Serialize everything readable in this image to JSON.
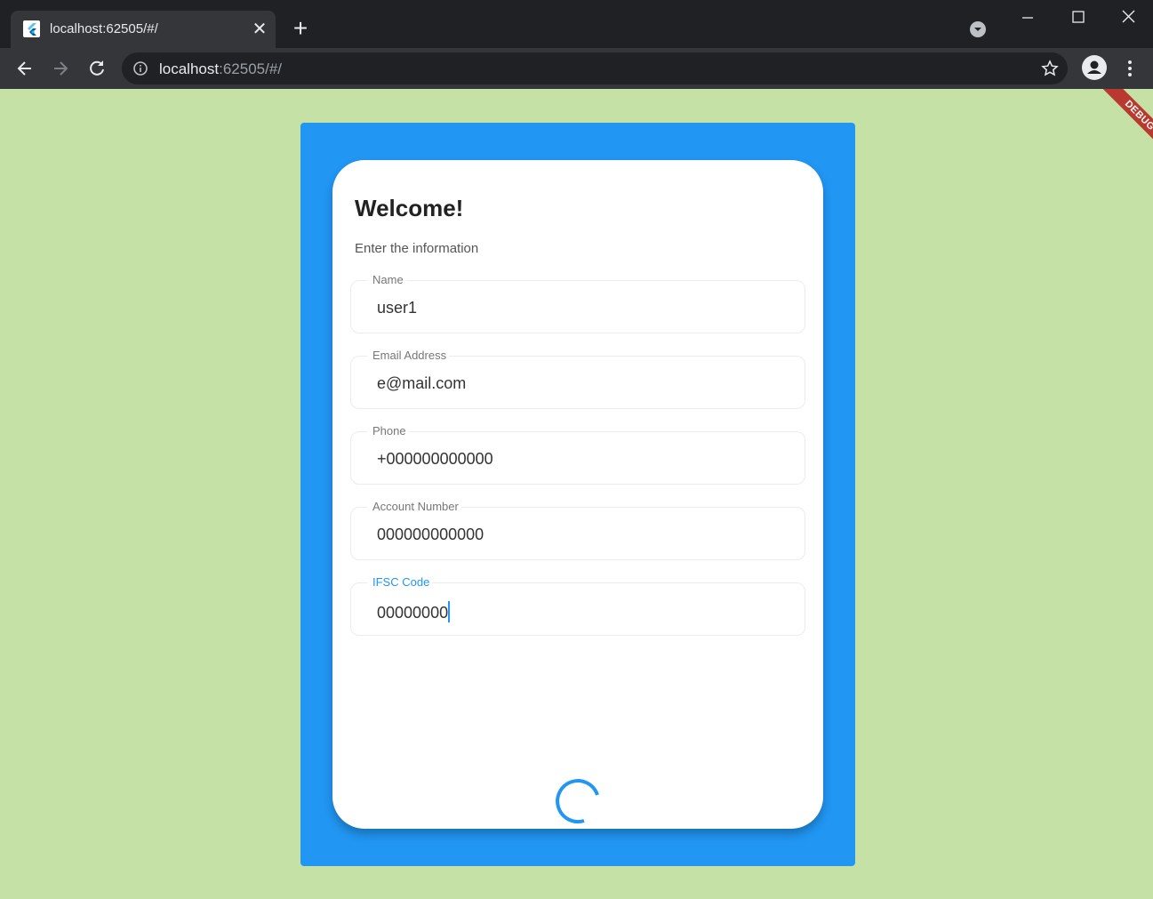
{
  "browser": {
    "tab": {
      "title": "localhost:62505/#/",
      "close": "✕"
    },
    "new_tab": "+",
    "url": {
      "host": "localhost",
      "rest": ":62505/#/"
    }
  },
  "debug_banner": "DEBUG",
  "form": {
    "title": "Welcome!",
    "subtitle": "Enter the information",
    "fields": [
      {
        "label": "Name",
        "value": "user1"
      },
      {
        "label": "Email Address",
        "value": "e@mail.com"
      },
      {
        "label": "Phone",
        "value": "+000000000000"
      },
      {
        "label": "Account Number",
        "value": "000000000000"
      },
      {
        "label": "IFSC Code",
        "value": "00000000",
        "focused": true
      }
    ]
  },
  "colors": {
    "page_background": "#c5e1a5",
    "panel": "#2196f3",
    "accent": "#2196f3",
    "debug": "#b71c1c"
  },
  "icons": {
    "favicon": "flutter-logo-icon",
    "tab_search": "tab-search-icon",
    "back": "arrow-left-icon",
    "forward": "arrow-right-icon",
    "reload": "reload-icon",
    "info": "info-icon",
    "bookmark": "star-icon",
    "profile": "person-icon",
    "menu": "kebab-menu-icon",
    "loading": "circular-progress-icon"
  }
}
